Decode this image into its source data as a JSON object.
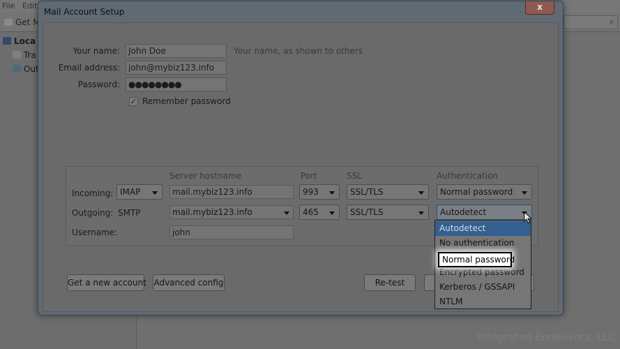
{
  "background": {
    "menu": [
      "File",
      "Edit"
    ],
    "toolbar_get_mail": "Get M",
    "folders": [
      "Loca",
      "Tra",
      "Out"
    ],
    "watermark": "Integrated Endeavors, LLC"
  },
  "dialog": {
    "title": "Mail Account Setup",
    "close_label": "x",
    "name_label": "Your name:",
    "name_value": "John Doe",
    "name_hint": "Your name, as shown to others",
    "email_label": "Email address:",
    "email_value": "john@mybiz123.info",
    "password_label": "Password:",
    "password_value": "●●●●●●●●",
    "remember_label": "Remember password",
    "remember_checked": "✓"
  },
  "server": {
    "headers": {
      "hostname": "Server hostname",
      "port": "Port",
      "ssl": "SSL",
      "auth": "Authentication"
    },
    "incoming": {
      "label": "Incoming:",
      "protocol": "IMAP",
      "hostname": "mail.mybiz123.info",
      "port": "993",
      "ssl": "SSL/TLS",
      "auth": "Normal password"
    },
    "outgoing": {
      "label": "Outgoing:",
      "protocol": "SMTP",
      "hostname": "mail.mybiz123.info",
      "port": "465",
      "ssl": "SSL/TLS",
      "auth": "Autodetect"
    },
    "username_label": "Username:",
    "username_value": "john"
  },
  "auth_dropdown": {
    "options": [
      "Autodetect",
      "No authentication",
      "Normal password",
      "Encrypted password",
      "Kerberos / GSSAPI",
      "NTLM"
    ]
  },
  "buttons": {
    "get_new_account": "Get a new account",
    "advanced_config": "Advanced config",
    "retest": "Re-test"
  }
}
